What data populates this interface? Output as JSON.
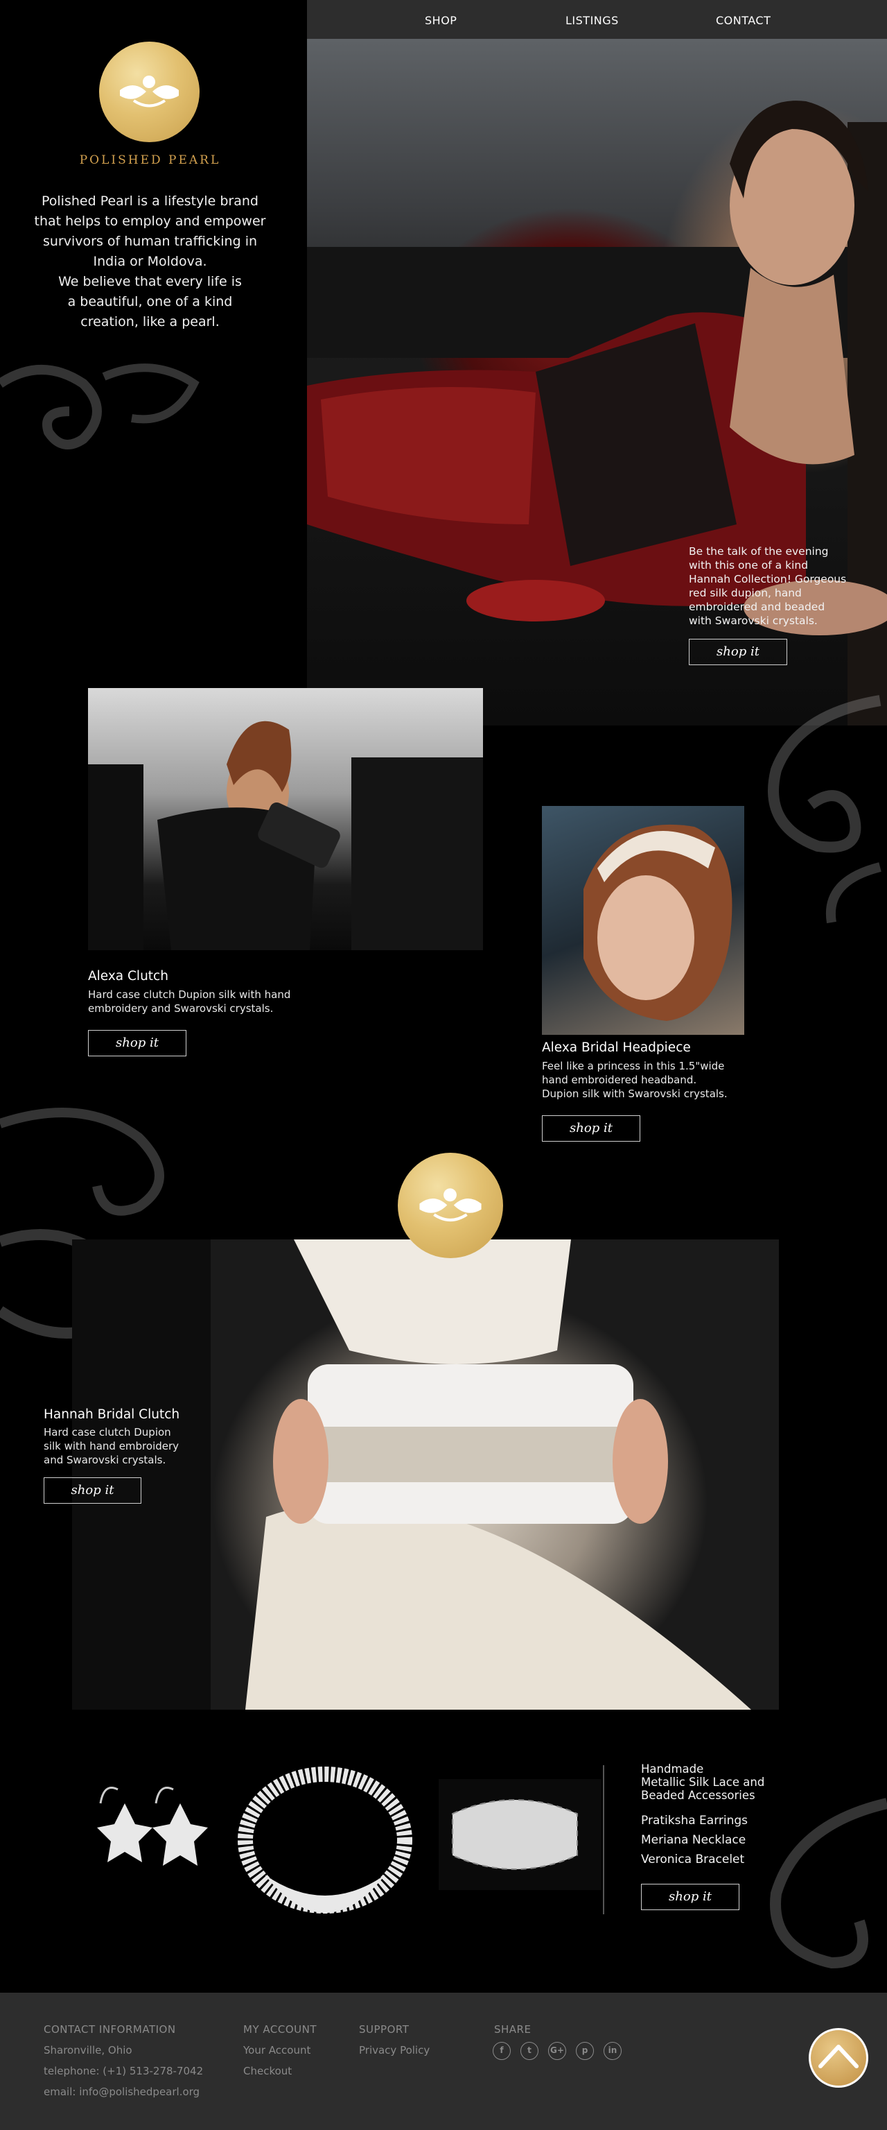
{
  "nav": {
    "items": [
      "SHOP",
      "LISTINGS",
      "CONTACT"
    ]
  },
  "brand": {
    "name": "POLISHED PEARL",
    "mission": [
      "Polished Pearl is a lifestyle brand",
      "that helps to employ and empower",
      "survivors of human trafficking in",
      "India or Moldova.",
      "We believe that every life is",
      "a beautiful, one of a kind",
      "creation, like a pearl."
    ]
  },
  "hero": {
    "text": [
      "Be the talk of the evening",
      "with this one of a kind",
      "Hannah Collection! Gorgeous",
      "red silk dupion, hand",
      "embroidered and beaded",
      "with Swarovski crystals."
    ],
    "button": "shop it"
  },
  "alexa_clutch": {
    "title": "Alexa Clutch",
    "desc": [
      "Hard case clutch Dupion silk with hand",
      "embroidery and Swarovski crystals."
    ],
    "button": "shop it"
  },
  "alexa_headpiece": {
    "title": "Alexa Bridal Headpiece",
    "desc": [
      "Feel like a princess in this 1.5\"wide",
      "hand embroidered headband.",
      "Dupion silk with Swarovski crystals."
    ],
    "button": "shop it"
  },
  "hannah_clutch": {
    "title": "Hannah Bridal Clutch",
    "desc": [
      "Hard case clutch Dupion",
      "silk with hand embroidery",
      "and Swarovski crystals."
    ],
    "button": "shop it"
  },
  "accessories": {
    "heading": [
      "Handmade",
      "Metallic Silk Lace and",
      "Beaded Accessories"
    ],
    "items": [
      "Pratiksha Earrings",
      "Meriana Necklace",
      "Veronica Bracelet"
    ],
    "button": "shop it"
  },
  "footer": {
    "contact": {
      "heading": "CONTACT INFORMATION",
      "lines": [
        "Sharonville, Ohio",
        "telephone: (+1) 513-278-7042",
        "email: info@polishedpearl.org"
      ]
    },
    "account": {
      "heading": "MY ACCOUNT",
      "links": [
        "Your Account",
        "Checkout"
      ]
    },
    "support": {
      "heading": "SUPPORT",
      "links": [
        "Privacy Policy"
      ]
    },
    "share": {
      "heading": "SHARE",
      "icons": [
        "f",
        "t",
        "G+",
        "p",
        "in"
      ]
    }
  },
  "colors": {
    "gold": "#d3a14f",
    "nav_bg": "#2d2d2d",
    "footer_bg": "#2d2d2d"
  }
}
